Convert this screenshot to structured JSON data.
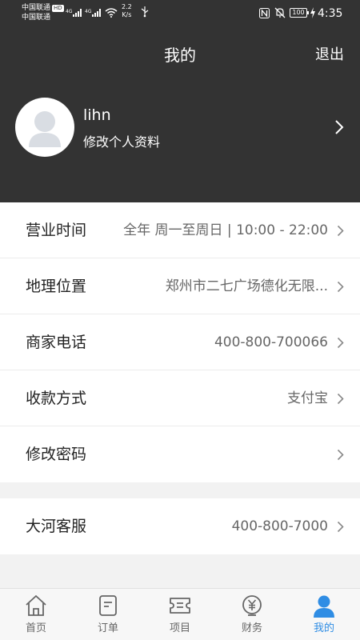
{
  "status_bar": {
    "carrier1": "中国联通",
    "hd_badge": "HD",
    "carrier2": "中国联通",
    "network1": "4G",
    "network2": "4G",
    "speed_value": "2.2",
    "speed_unit": "K/s",
    "battery": "100",
    "time": "4:35"
  },
  "nav": {
    "title": "我的",
    "logout_label": "退出"
  },
  "profile": {
    "username": "lihn",
    "edit_label": "修改个人资料"
  },
  "settings_group1": [
    {
      "label": "营业时间",
      "value": "全年 周一至周日 | 10:00 - 22:00"
    },
    {
      "label": "地理位置",
      "value": "郑州市二七广场德化无限..."
    },
    {
      "label": "商家电话",
      "value": "400-800-700066"
    },
    {
      "label": "收款方式",
      "value": "支付宝"
    },
    {
      "label": "修改密码",
      "value": ""
    }
  ],
  "settings_group2": [
    {
      "label": "大河客服",
      "value": "400-800-7000"
    }
  ],
  "tabbar": {
    "items": [
      {
        "label": "首页",
        "icon": "home-icon"
      },
      {
        "label": "订单",
        "icon": "order-icon"
      },
      {
        "label": "项目",
        "icon": "project-icon"
      },
      {
        "label": "财务",
        "icon": "finance-icon"
      },
      {
        "label": "我的",
        "icon": "profile-icon"
      }
    ],
    "active_index": 4
  },
  "colors": {
    "header_bg": "#333333",
    "accent": "#2f8de4",
    "page_bg": "#f2f2f2"
  }
}
